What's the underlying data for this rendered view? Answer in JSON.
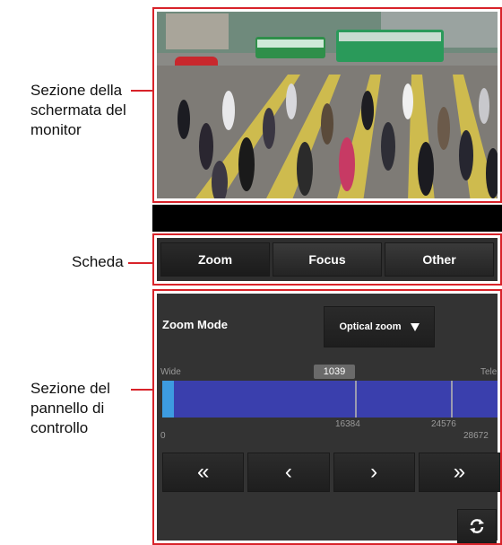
{
  "callouts": {
    "monitor": "Sezione della schermata del monitor",
    "tabs": "Scheda",
    "panel": "Sezione del pannello di controllo"
  },
  "tabs": [
    {
      "label": "Zoom",
      "active": true
    },
    {
      "label": "Focus",
      "active": false
    },
    {
      "label": "Other",
      "active": false
    }
  ],
  "control_panel": {
    "zoom_mode_label": "Zoom Mode",
    "zoom_mode_value": "Optical zoom",
    "scale_left_label": "Wide",
    "scale_right_label": "Tele",
    "current_zoom": "1039",
    "tick_labels": {
      "start": "0",
      "mid": "16384",
      "digital": "24576",
      "end": "28672"
    },
    "zoom_position_fraction": 0.036,
    "buttons": {
      "fast_wide": "«",
      "step_wide": "‹",
      "step_tele": "›",
      "fast_tele": "»"
    }
  },
  "colors": {
    "callout_line": "#d8232a",
    "zoom_track": "#3a3fad",
    "zoom_fill": "#3d9be0"
  }
}
